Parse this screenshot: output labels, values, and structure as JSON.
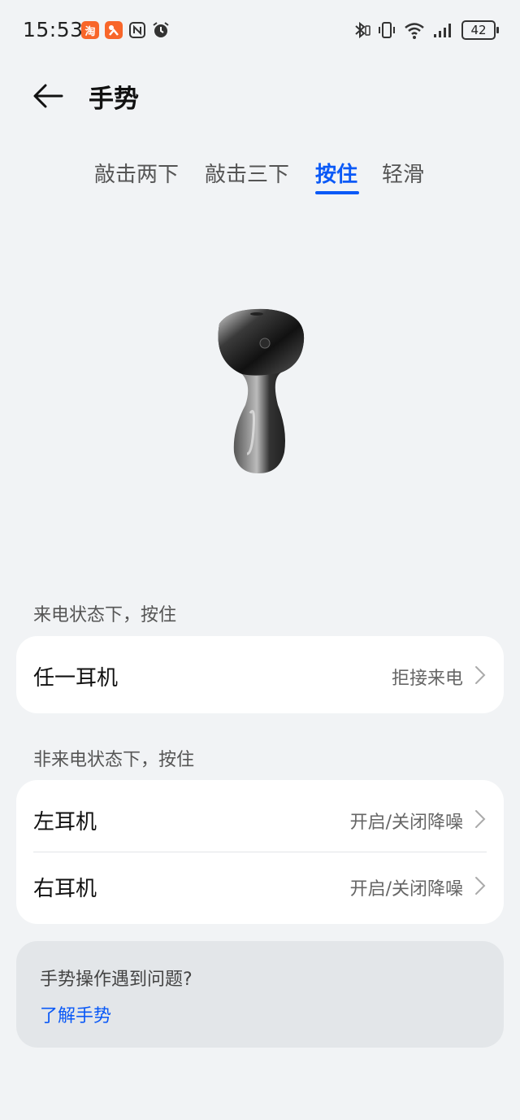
{
  "status_bar": {
    "time": "15:53",
    "battery": "42",
    "icons": [
      "taobao-icon",
      "xianyu-icon",
      "nfc-icon",
      "alarm-icon",
      "bluetooth-icon",
      "vibrate-icon",
      "wifi-icon",
      "signal-icon",
      "battery-icon"
    ]
  },
  "header": {
    "title": "手势"
  },
  "tabs": [
    {
      "label": "敲击两下",
      "active": false
    },
    {
      "label": "敲击三下",
      "active": false
    },
    {
      "label": "按住",
      "active": true
    },
    {
      "label": "轻滑",
      "active": false
    }
  ],
  "incoming_call": {
    "section_label": "来电状态下，按住",
    "rows": [
      {
        "label": "任一耳机",
        "value": "拒接来电"
      }
    ]
  },
  "non_call": {
    "section_label": "非来电状态下，按住",
    "rows": [
      {
        "label": "左耳机",
        "value": "开启/关闭降噪"
      },
      {
        "label": "右耳机",
        "value": "开启/关闭降噪"
      }
    ]
  },
  "help": {
    "question": "手势操作遇到问题?",
    "link": "了解手势"
  },
  "colors": {
    "accent": "#0a59f7",
    "background": "#f1f3f5",
    "card": "#ffffff"
  }
}
